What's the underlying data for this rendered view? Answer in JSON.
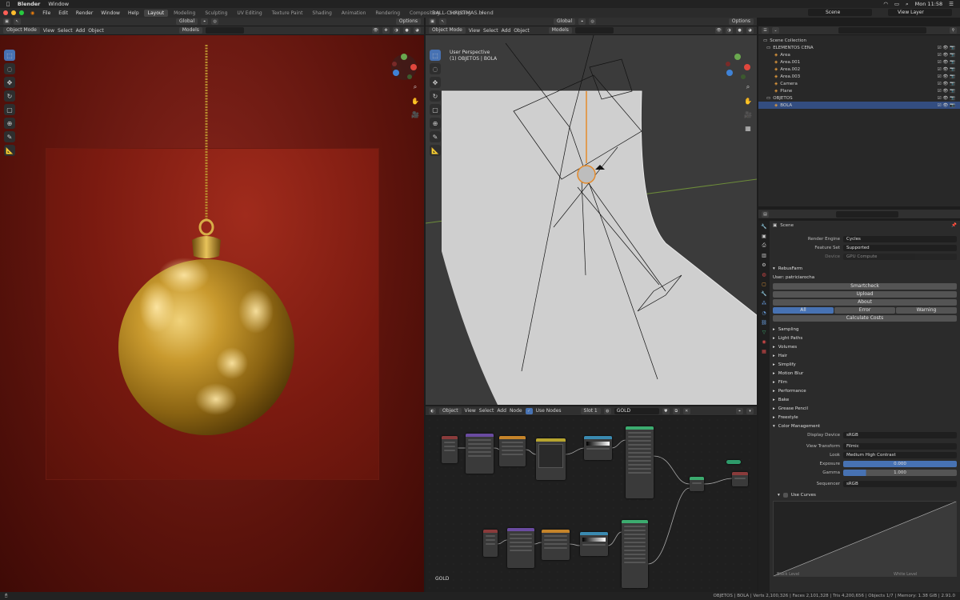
{
  "mac": {
    "app_name": "Blender",
    "menus": [
      "Window"
    ],
    "clock": "Mon 11:58"
  },
  "blender": {
    "file_title": "BALL-CHRISTMAS.blend",
    "menus": [
      "File",
      "Edit",
      "Render",
      "Window",
      "Help"
    ],
    "workspaces": [
      "Layout",
      "Modeling",
      "Sculpting",
      "UV Editing",
      "Texture Paint",
      "Shading",
      "Animation",
      "Rendering",
      "Compositing",
      "Scripting"
    ],
    "active_workspace": "Layout",
    "scene": "Scene",
    "view_layer": "View Layer"
  },
  "left_view": {
    "mode": "Object Mode",
    "menus": [
      "View",
      "Select",
      "Add",
      "Object"
    ],
    "orientation": "Global",
    "options": "Options",
    "search_label": "Models"
  },
  "view3d": {
    "mode": "Object Mode",
    "menus": [
      "View",
      "Select",
      "Add",
      "Object"
    ],
    "orientation": "Global",
    "options": "Options",
    "search_label": "Models",
    "perspective": "User Perspective",
    "context": "(1) OBJETOS | BOLA"
  },
  "node_editor": {
    "editor_type": "Object",
    "menus": [
      "View",
      "Select",
      "Add",
      "Node"
    ],
    "use_nodes_label": "Use Nodes",
    "slot": "Slot 1",
    "material": "GOLD",
    "label": "GOLD"
  },
  "outliner": {
    "root": "Scene Collection",
    "items": [
      {
        "label": "ELEMENTOS CENA",
        "level": 0,
        "color": "#cfcfcf"
      },
      {
        "label": "Area",
        "level": 1,
        "color": "#e49b3c"
      },
      {
        "label": "Area.001",
        "level": 1,
        "color": "#e49b3c"
      },
      {
        "label": "Area.002",
        "level": 1,
        "color": "#e49b3c"
      },
      {
        "label": "Area.003",
        "level": 1,
        "color": "#e49b3c"
      },
      {
        "label": "Camera",
        "level": 1,
        "color": "#e49b3c"
      },
      {
        "label": "Plane",
        "level": 1,
        "color": "#e49b3c"
      },
      {
        "label": "OBJETOS",
        "level": 0,
        "color": "#cfcfcf"
      },
      {
        "label": "BOLA",
        "level": 1,
        "color": "#e49b3c"
      }
    ]
  },
  "properties": {
    "scene_label": "Scene",
    "render_engine_label": "Render Engine",
    "render_engine": "Cycles",
    "feature_set_label": "Feature Set",
    "feature_set": "Supported",
    "device_label": "Device",
    "device": "GPU Compute",
    "renderfarm_panel": "RebusFarm",
    "user": "User: patriciarocha",
    "buttons": [
      "Smartcheck",
      "Upload",
      "About"
    ],
    "tabs": [
      "All",
      "Error",
      "Warning"
    ],
    "calc_costs": "Calculate Costs",
    "panels": [
      "Sampling",
      "Light Paths",
      "Volumes",
      "Hair",
      "Simplify",
      "Motion Blur",
      "Film",
      "Performance",
      "Bake",
      "Grease Pencil",
      "Freestyle",
      "Color Management"
    ],
    "display_device_label": "Display Device",
    "display_device": "sRGB",
    "view_transform_label": "View Transform",
    "view_transform": "Filmic",
    "look_label": "Look",
    "look": "Medium High Contrast",
    "exposure_label": "Exposure",
    "exposure": "0.000",
    "gamma_label": "Gamma",
    "gamma": "1.000",
    "sequencer_label": "Sequencer",
    "sequencer": "sRGB",
    "use_curves_label": "Use Curves",
    "black_level": "Black Level",
    "white_level": "White Level"
  },
  "status": {
    "text": "OBJETOS | BOLA | Verts 2,100,326 | Faces 2,101,328 | Tris 4,200,656 | Objects 1/7 | Memory: 1.38 GiB | 2.91.0"
  }
}
